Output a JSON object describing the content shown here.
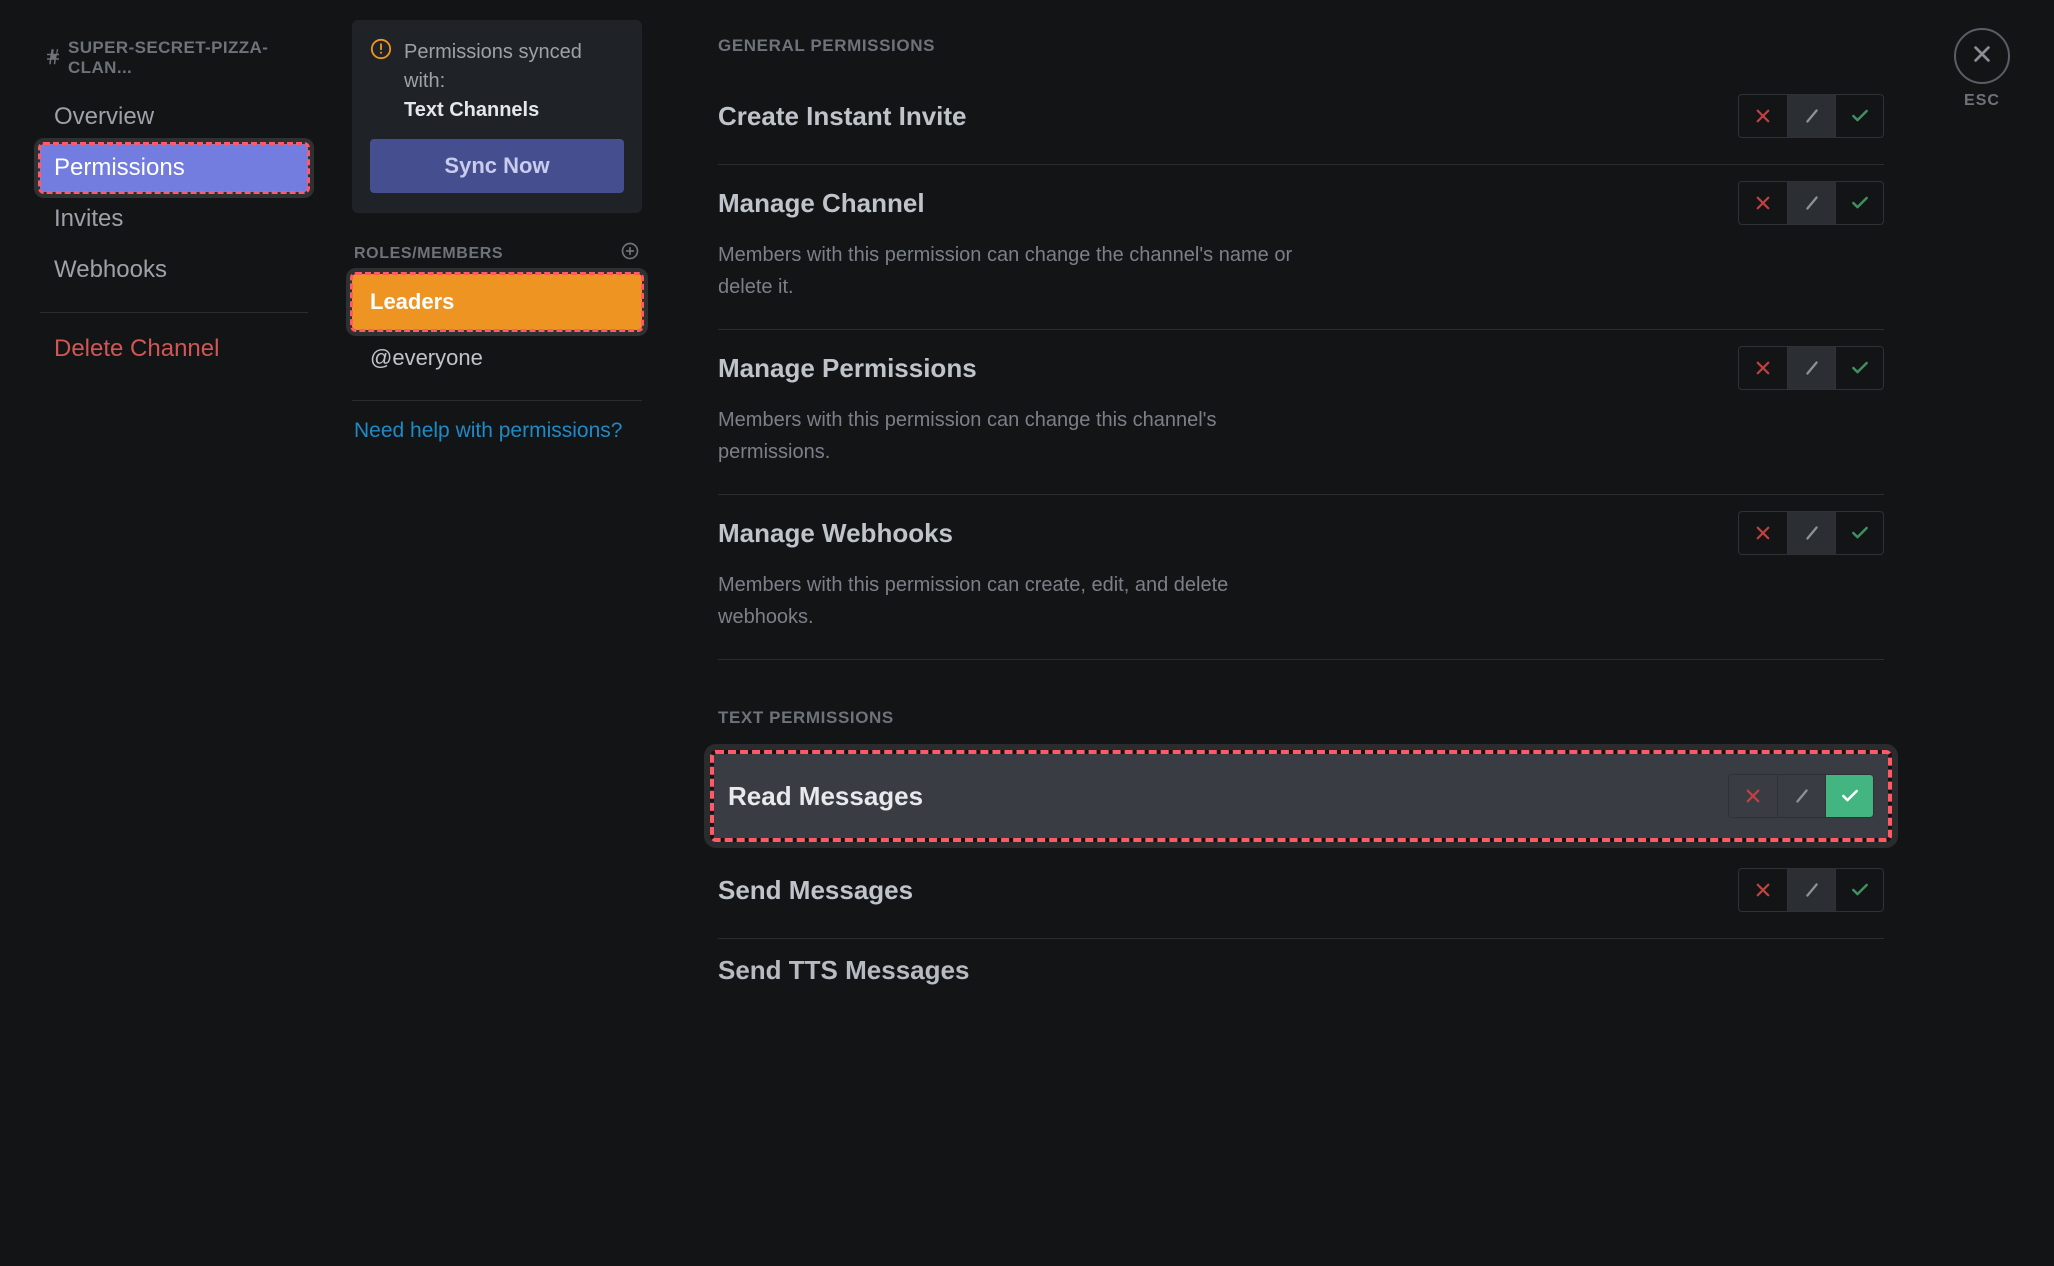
{
  "channel_header": "SUPER-SECRET-PIZZA-CLAN...",
  "close_label": "ESC",
  "sidebar": {
    "items": [
      {
        "label": "Overview",
        "active": false
      },
      {
        "label": "Permissions",
        "active": true
      },
      {
        "label": "Invites",
        "active": false
      },
      {
        "label": "Webhooks",
        "active": false
      }
    ],
    "delete_label": "Delete Channel"
  },
  "sync_box": {
    "line": "Permissions synced with:",
    "target": "Text Channels",
    "button": "Sync Now"
  },
  "roles_header": "ROLES/MEMBERS",
  "roles": [
    {
      "label": "Leaders",
      "selected": true
    },
    {
      "label": "@everyone",
      "selected": false
    }
  ],
  "help_link": "Need help with permissions?",
  "sections": [
    {
      "label": "GENERAL PERMISSIONS",
      "perms": [
        {
          "key": "create-invite",
          "title": "Create Instant Invite",
          "desc": "",
          "state": "neutral",
          "highlight": false
        },
        {
          "key": "manage-channel",
          "title": "Manage Channel",
          "desc": "Members with this permission can change the channel's name or delete it.",
          "state": "neutral",
          "highlight": false
        },
        {
          "key": "manage-perms",
          "title": "Manage Permissions",
          "desc": "Members with this permission can change this channel's permissions.",
          "state": "neutral",
          "highlight": false
        },
        {
          "key": "manage-webhooks",
          "title": "Manage Webhooks",
          "desc": "Members with this permission can create, edit, and delete webhooks.",
          "state": "neutral",
          "highlight": false
        }
      ]
    },
    {
      "label": "TEXT PERMISSIONS",
      "perms": [
        {
          "key": "read-messages",
          "title": "Read Messages",
          "desc": "",
          "state": "allow",
          "highlight": true
        },
        {
          "key": "send-messages",
          "title": "Send Messages",
          "desc": "",
          "state": "neutral",
          "highlight": false
        },
        {
          "key": "send-tts",
          "title": "Send TTS Messages",
          "desc": "",
          "state": "neutral",
          "highlight": false
        }
      ]
    }
  ]
}
